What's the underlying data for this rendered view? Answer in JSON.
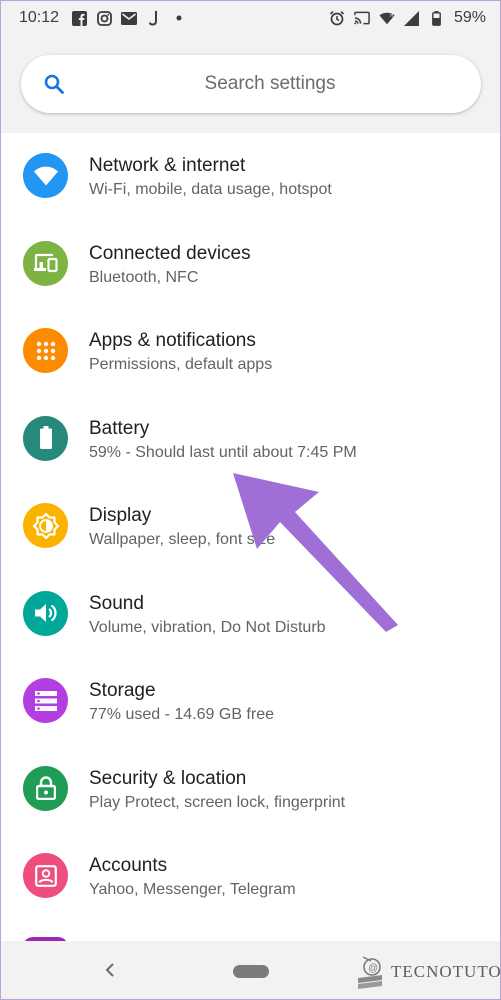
{
  "status_bar": {
    "time": "10:12",
    "battery": "59%",
    "left_icons": [
      "facebook-icon",
      "instagram-icon",
      "gmail-icon",
      "notification-icon",
      "dot-icon"
    ],
    "right_icons": [
      "alarm-icon",
      "cast-icon",
      "wifi-icon",
      "signal-icon",
      "battery-icon"
    ]
  },
  "search": {
    "placeholder": "Search settings"
  },
  "settings": [
    {
      "title": "Network & internet",
      "subtitle": "Wi-Fi, mobile, data usage, hotspot",
      "icon": "wifi-icon",
      "color": "#2196f3"
    },
    {
      "title": "Connected devices",
      "subtitle": "Bluetooth, NFC",
      "icon": "devices-icon",
      "color": "#7cb342"
    },
    {
      "title": "Apps & notifications",
      "subtitle": "Permissions, default apps",
      "icon": "apps-grid-icon",
      "color": "#fb8c00"
    },
    {
      "title": "Battery",
      "subtitle": "59% - Should last until about 7:45 PM",
      "icon": "battery-icon",
      "color": "#26897b"
    },
    {
      "title": "Display",
      "subtitle": "Wallpaper, sleep, font size",
      "icon": "brightness-icon",
      "color": "#fbb300"
    },
    {
      "title": "Sound",
      "subtitle": "Volume, vibration, Do Not Disturb",
      "icon": "volume-icon",
      "color": "#00a89a"
    },
    {
      "title": "Storage",
      "subtitle": "77% used - 14.69 GB free",
      "icon": "storage-icon",
      "color": "#b43ee0"
    },
    {
      "title": "Security & location",
      "subtitle": "Play Protect, screen lock, fingerprint",
      "icon": "lock-icon",
      "color": "#1f9d55"
    },
    {
      "title": "Accounts",
      "subtitle": "Yahoo, Messenger, Telegram",
      "icon": "account-icon",
      "color": "#ee4d7e"
    }
  ],
  "annotation": {
    "arrow_color": "#a06fd6"
  },
  "watermark": {
    "text": "TECNOTUTO"
  }
}
